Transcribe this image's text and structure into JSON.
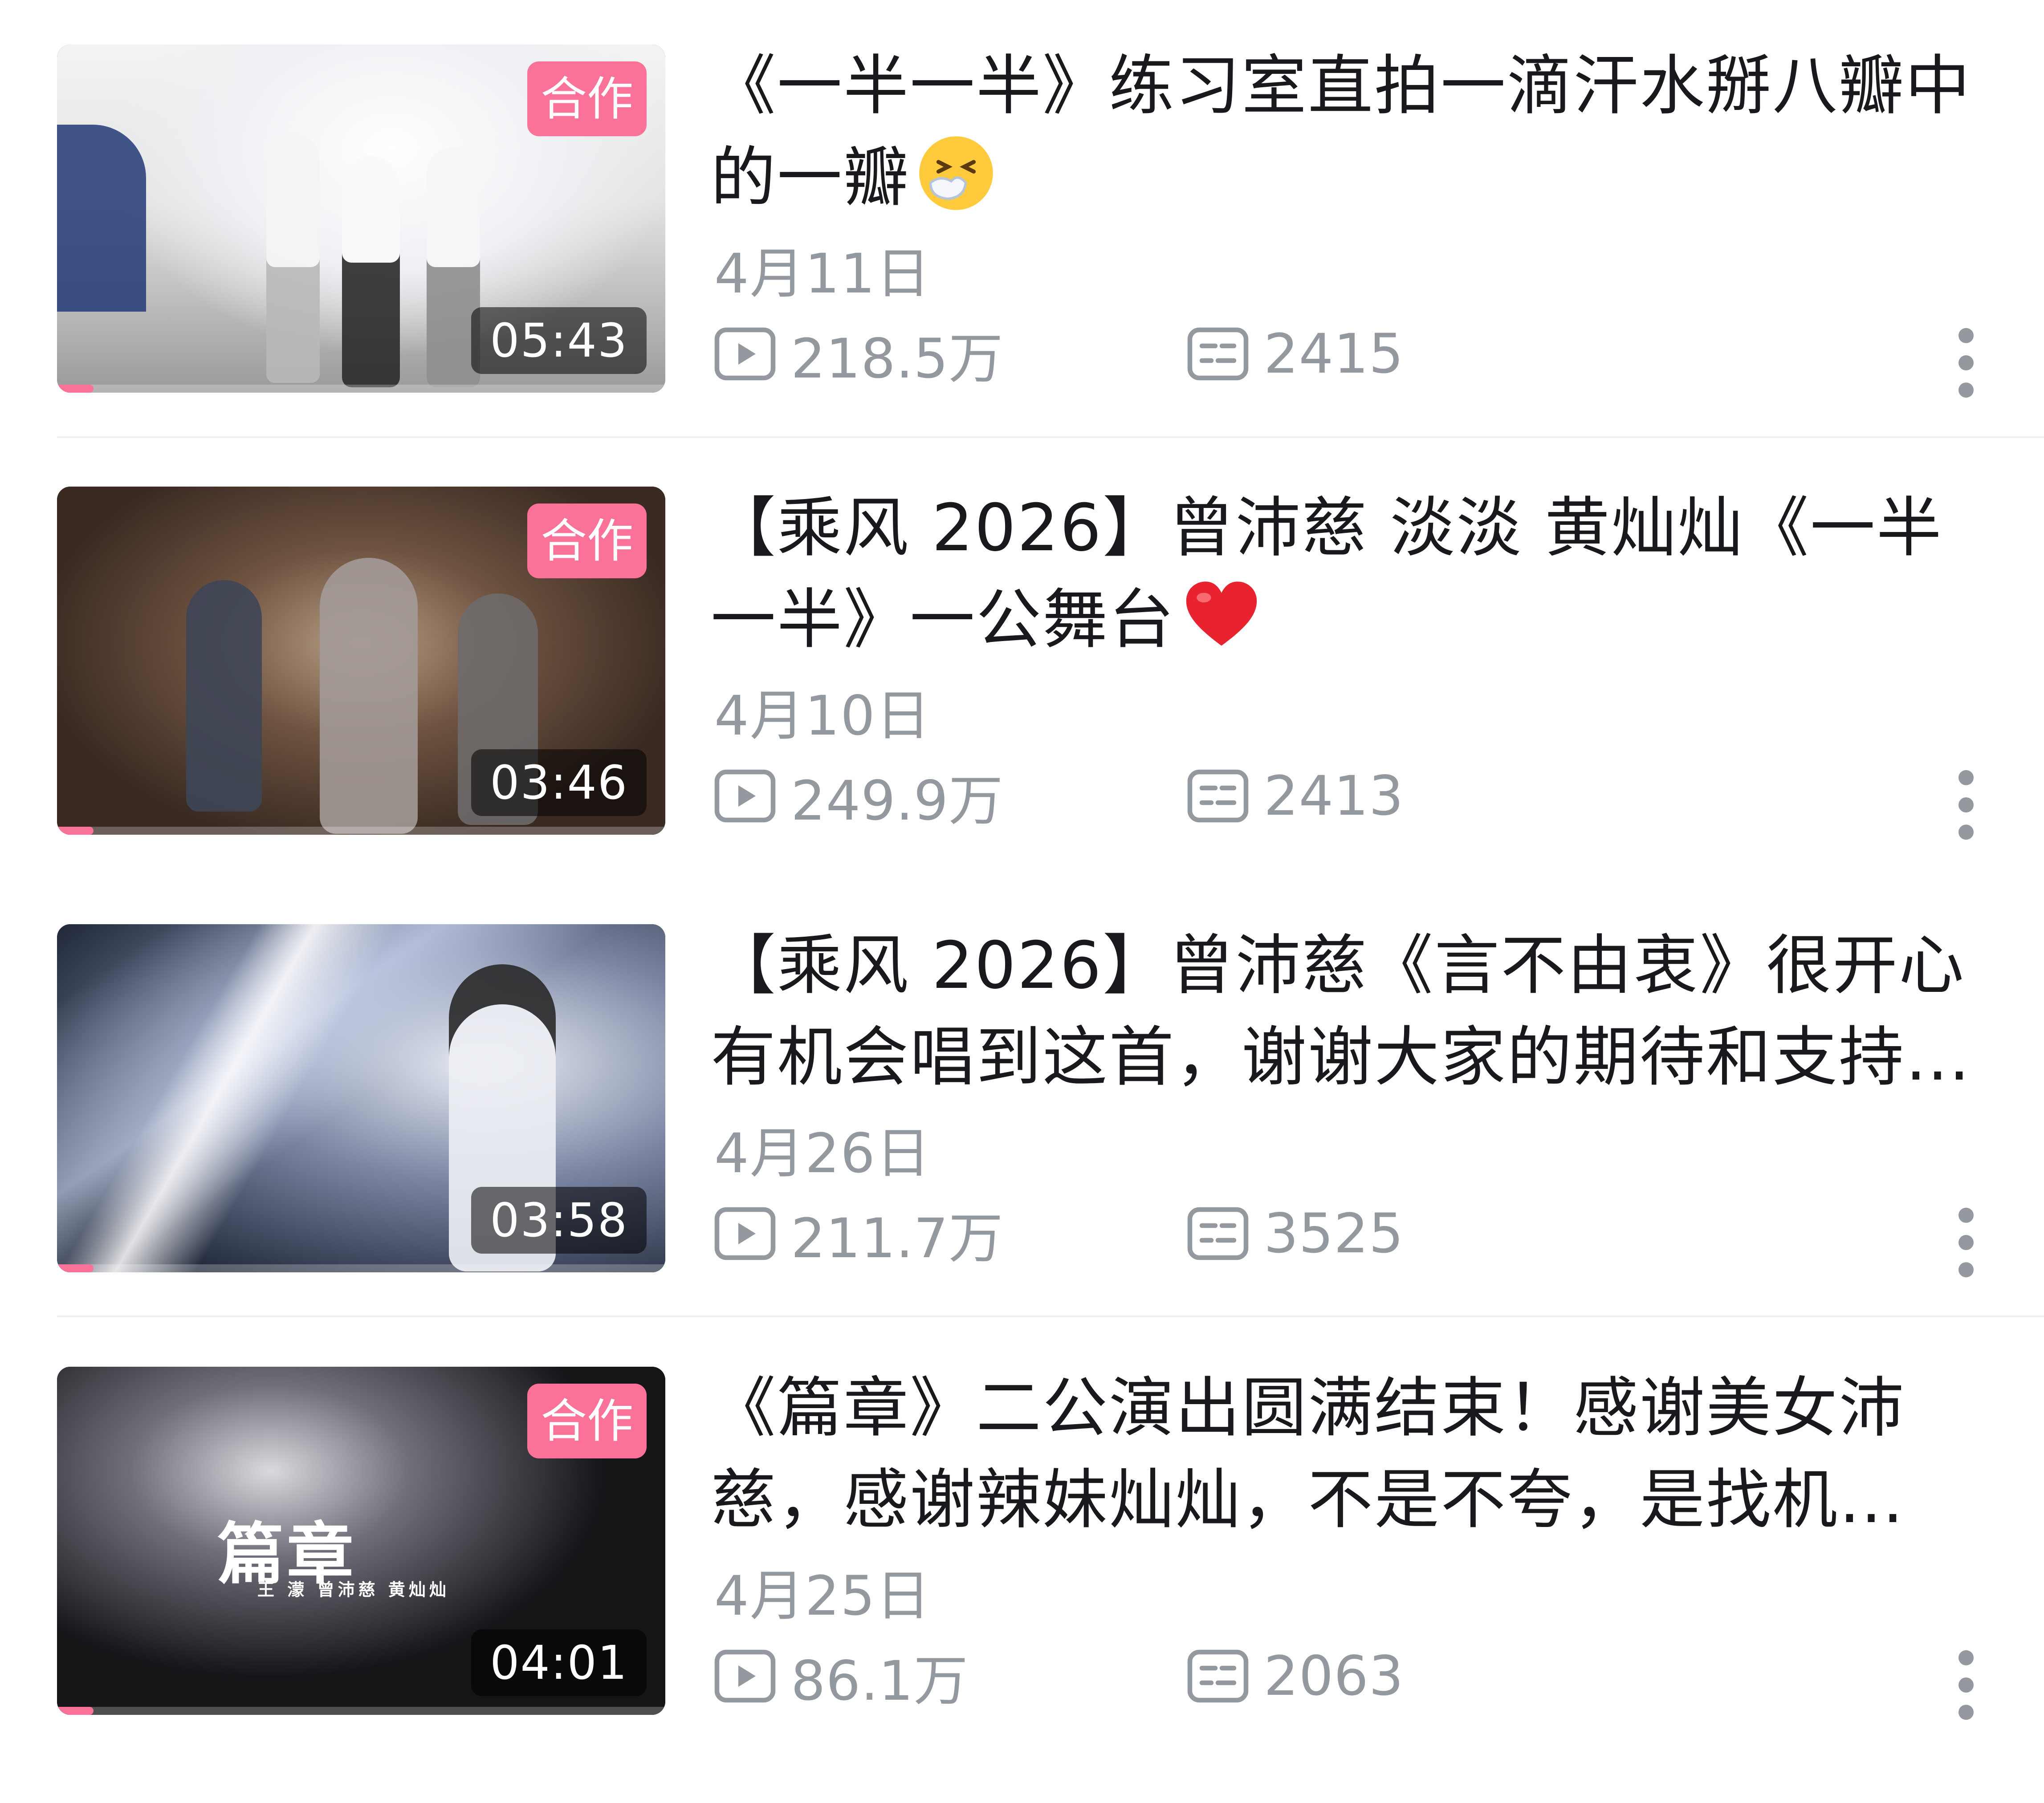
{
  "colors": {
    "accent": "#fb7299",
    "text_primary": "#18191c",
    "text_secondary": "#9499a0",
    "divider": "#eceff3"
  },
  "icons": {
    "views": "play-icon",
    "comments": "danmaku-icon",
    "more": "more-vertical-icon"
  },
  "videos": [
    {
      "title": "《一半一半》练习室直拍一滴汗水掰八瓣中的一瓣",
      "title_emoji": "sneezing-face-emoji",
      "badge": "合作",
      "duration": "05:43",
      "date": "4月11日",
      "views": "218.5万",
      "comments": "2415",
      "watch_progress": 0.06
    },
    {
      "title": "【乘风 2026】曾沛慈 淡淡 黄灿灿《一半一半》一公舞台",
      "title_emoji": "red-heart-emoji",
      "badge": "合作",
      "duration": "03:46",
      "date": "4月10日",
      "views": "249.9万",
      "comments": "2413",
      "watch_progress": 0.06
    },
    {
      "title": "【乘风 2026】曾沛慈《言不由衷》很开心有机会唱到这首，谢谢大家的期待和支持…",
      "duration": "03:58",
      "date": "4月26日",
      "views": "211.7万",
      "comments": "3525",
      "watch_progress": 0.06
    },
    {
      "title": "《篇章》二公演出圆满结束！感谢美女沛慈，感谢辣妹灿灿，不是不夸，是找机…",
      "badge": "合作",
      "duration": "04:01",
      "date": "4月25日",
      "views": "86.1万",
      "comments": "2063",
      "watch_progress": 0.06,
      "poster_title": "篇章",
      "poster_names": "王 濛 曾沛慈 黄灿灿"
    }
  ]
}
